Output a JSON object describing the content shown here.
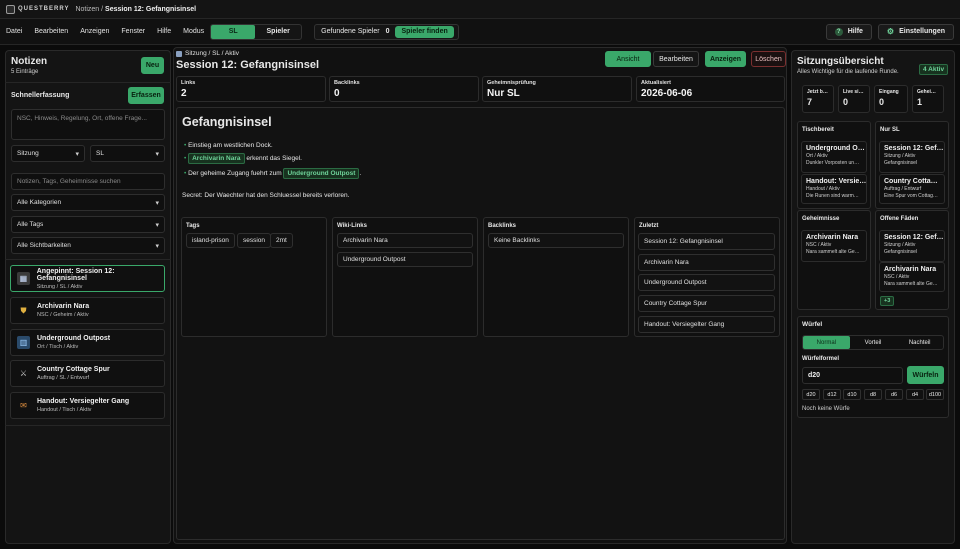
{
  "app": {
    "logo": "QUESTBERRY",
    "crumb_parent": "Notizen",
    "crumb_current": "Session 12: Gefangnisinsel"
  },
  "menu": [
    "Datei",
    "Bearbeiten",
    "Anzeigen",
    "Fenster",
    "Hilfe",
    "Modus"
  ],
  "mode": {
    "sl": "SL",
    "player": "Spieler"
  },
  "found": {
    "label": "Gefundene Spieler",
    "count": "0",
    "button": "Spieler finden"
  },
  "top_right": {
    "help": "Hilfe",
    "settings": "Einstellungen"
  },
  "left": {
    "title": "Notizen",
    "count": "5 Einträge",
    "new": "Neu",
    "quick_label": "Schnellerfassung",
    "quick_button": "Erfassen",
    "quick_placeholder": "NSC, Hinweis, Regelung, Ort, offene Frage...",
    "type_select": "Sitzung",
    "vis_select": "SL",
    "search_placeholder": "Notizen, Tags, Geheimnisse suchen",
    "filter_cat": "Alle Kategorien",
    "filter_tags": "Alle Tags",
    "filter_vis": "Alle Sichtbarkeiten",
    "notes": [
      {
        "title": "Angepinnt: Session 12: Gefangnisinsel",
        "sub": "Sitzung / SL / Aktiv",
        "icon": "calendar-icon"
      },
      {
        "title": "Archivarin Nara",
        "sub": "NSC / Geheim / Aktiv",
        "icon": "shield-icon"
      },
      {
        "title": "Underground Outpost",
        "sub": "Ort / Tisch / Aktiv",
        "icon": "map-icon"
      },
      {
        "title": "Country Cottage Spur",
        "sub": "Auftrag / SL / Entwurf",
        "icon": "swords-icon"
      },
      {
        "title": "Handout: Versiegelter Gang",
        "sub": "Handout / Tisch / Aktiv",
        "icon": "scroll-icon"
      }
    ]
  },
  "center": {
    "crumb": "Sitzung / SL / Aktiv",
    "title": "Session 12: Gefangnisinsel",
    "actions": {
      "view": "Ansicht",
      "edit": "Bearbeiten",
      "show": "Anzeigen",
      "delete": "Löschen"
    },
    "stats": [
      {
        "label": "Links",
        "value": "2"
      },
      {
        "label": "Backlinks",
        "value": "0"
      },
      {
        "label": "Geheimnisprüfung",
        "value": "Nur SL"
      },
      {
        "label": "Aktualisiert",
        "value": "2026-06-06"
      }
    ],
    "doc_title": "Gefangnisinsel",
    "bullet1": "Einstieg am westlichen Dock.",
    "bullet2_link": "Archivarin Nara",
    "bullet2_rest": "erkennt das Siegel.",
    "bullet3_pre": "Der geheime Zugang fuehrt zum",
    "bullet3_link": "Underground Outpost",
    "bullet3_post": ".",
    "secret": "Secret: Der Waechter hat den Schluessel bereits verloren.",
    "tags_title": "Tags",
    "tags": [
      "island-prison",
      "session",
      "2mt"
    ],
    "wiki_title": "Wiki-Links",
    "wiki": [
      "Archivarin Nara",
      "Underground Outpost"
    ],
    "back_title": "Backlinks",
    "back": [
      "Keine Backlinks"
    ],
    "recent_title": "Zuletzt",
    "recent": [
      "Session 12: Gefangnisinsel",
      "Archivarin Nara",
      "Underground Outpost",
      "Country Cottage Spur",
      "Handout: Versiegelter Gang"
    ]
  },
  "right": {
    "title": "Sitzungsübersicht",
    "subtitle": "Alles Wichtige für die laufende Runde.",
    "badge": "4 Aktiv",
    "stats": [
      {
        "label": "Jetzt b…",
        "value": "7"
      },
      {
        "label": "Live si…",
        "value": "0"
      },
      {
        "label": "Eingang",
        "value": "0"
      },
      {
        "label": "Gehei…",
        "value": "1"
      }
    ],
    "table_title": "Tischbereit",
    "table": [
      {
        "t": "Underground O…",
        "s1": "Ort / Aktiv",
        "s2": "Dunkler Vorposten un…"
      },
      {
        "t": "Handout: Versie…",
        "s1": "Handout / Aktiv",
        "s2": "Die Runen sind warm…"
      }
    ],
    "sl_title": "Nur SL",
    "sl": [
      {
        "t": "Session 12: Gef…",
        "s1": "Sitzung / Aktiv",
        "s2": "Gefangnisinsel"
      },
      {
        "t": "Country Cotta…",
        "s1": "Auftrag / Entwurf",
        "s2": "Eine Spur vom Cottag…"
      }
    ],
    "sec_title": "Geheimnisse",
    "sec": [
      {
        "t": "Archivarin Nara",
        "s1": "NSC / Aktiv",
        "s2": "Nara sammelt alte Ge…"
      }
    ],
    "open_title": "Offene Fäden",
    "open": [
      {
        "t": "Session 12: Gef…",
        "s1": "Sitzung / Aktiv",
        "s2": "Gefangnisinsel"
      },
      {
        "t": "Archivarin Nara",
        "s1": "NSC / Aktiv",
        "s2": "Nara sammelt alte Ge…"
      }
    ],
    "open_more": "+3",
    "dice_title": "Würfel",
    "dice_modes": [
      "Normal",
      "Vorteil",
      "Nachteil"
    ],
    "formula_label": "Würfelformel",
    "formula": "d20",
    "roll": "Würfeln",
    "dice": [
      "d20",
      "d12",
      "d10",
      "d8",
      "d6",
      "d4",
      "d100"
    ],
    "no_rolls": "Noch keine Würfe"
  },
  "colors": {
    "accent": "#3aa86a",
    "bg": "#0b0b0b",
    "panel": "#141414"
  }
}
